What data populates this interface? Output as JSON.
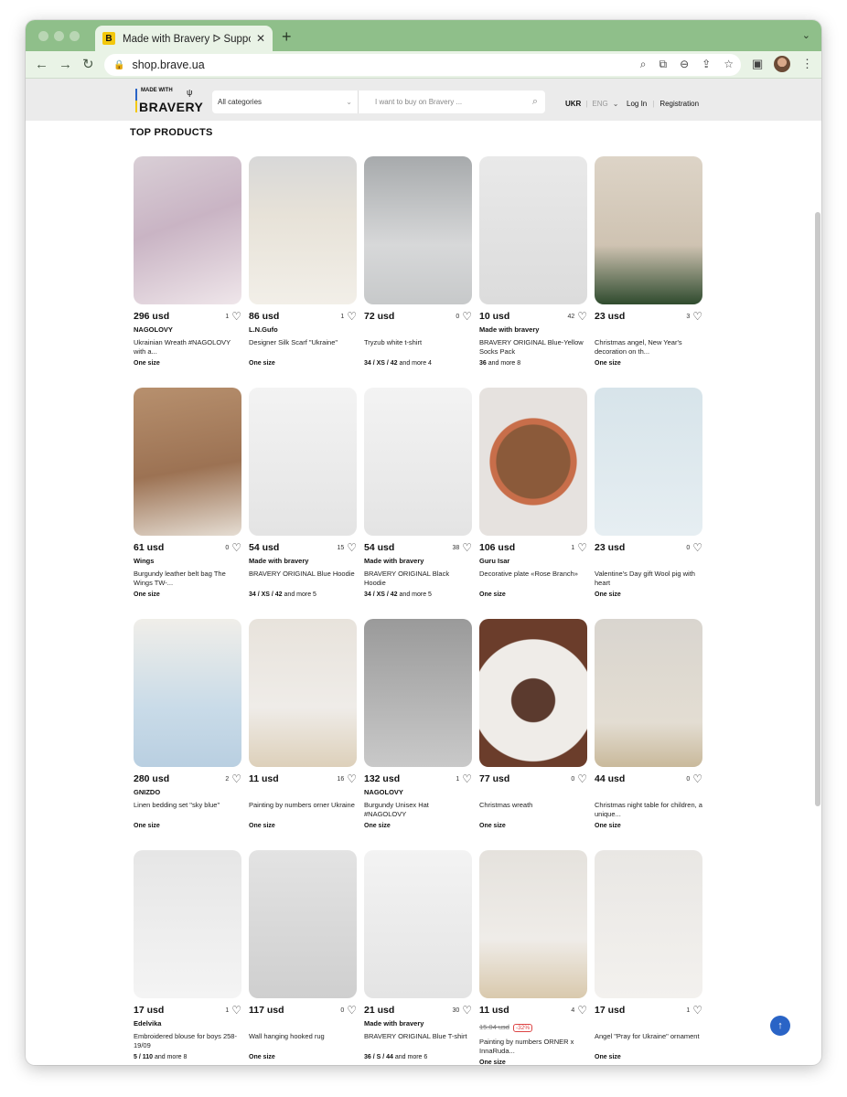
{
  "browser": {
    "tab_title": "Made with Bravery ᐅ Support U",
    "favicon_letter": "B",
    "url": "shop.brave.ua"
  },
  "site": {
    "logo_small": "MADE WITH",
    "logo_big": "BRAVERY",
    "category_select": "All categories",
    "search_placeholder": "I want to buy on Bravery ...",
    "lang_active": "UKR",
    "lang_inactive": "ENG",
    "login": "Log In",
    "register": "Registration",
    "section_title": "TOP PRODUCTS"
  },
  "products": [
    {
      "price": "296 usd",
      "likes": "1",
      "brand": "NAGOLOVY",
      "title": "Ukrainian Wreath #NAGOLOVY with a...",
      "size": "One size",
      "more": ""
    },
    {
      "price": "86 usd",
      "likes": "1",
      "brand": "L.N.Gufo",
      "title": "Designer Silk Scarf \"Ukraine\"",
      "size": "One size",
      "more": ""
    },
    {
      "price": "72 usd",
      "likes": "0",
      "brand": "",
      "title": "Tryzub white t-shirt",
      "size": "34 / XS / 42",
      "more": "and more 4"
    },
    {
      "price": "10 usd",
      "likes": "42",
      "brand": "Made with bravery",
      "title": "BRAVERY ORIGINAL Blue-Yellow Socks Pack",
      "size": "36",
      "more": "and more 8"
    },
    {
      "price": "23 usd",
      "likes": "3",
      "brand": "",
      "title": "Christmas angel, New Year's decoration on th...",
      "size": "One size",
      "more": ""
    },
    {
      "price": "61 usd",
      "likes": "0",
      "brand": "Wings",
      "title": "Burgundy leather belt bag The Wings TW-...",
      "size": "One size",
      "more": ""
    },
    {
      "price": "54 usd",
      "likes": "15",
      "brand": "Made with bravery",
      "title": "BRAVERY ORIGINAL Blue Hoodie",
      "size": "34 / XS / 42",
      "more": "and more 5"
    },
    {
      "price": "54 usd",
      "likes": "38",
      "brand": "Made with bravery",
      "title": "BRAVERY ORIGINAL Black Hoodie",
      "size": "34 / XS / 42",
      "more": "and more 5"
    },
    {
      "price": "106 usd",
      "likes": "1",
      "brand": "Guru Isar",
      "title": "Decorative plate «Rose Branch»",
      "size": "One size",
      "more": ""
    },
    {
      "price": "23 usd",
      "likes": "0",
      "brand": "",
      "title": "Valentine's Day gift Wool pig with heart",
      "size": "One size",
      "more": ""
    },
    {
      "price": "280 usd",
      "likes": "2",
      "brand": "GNIZDO",
      "title": "Linen bedding set \"sky blue\"",
      "size": "One size",
      "more": ""
    },
    {
      "price": "11 usd",
      "likes": "16",
      "brand": "",
      "title": "Painting by numbers orner Ukraine",
      "size": "One size",
      "more": ""
    },
    {
      "price": "132 usd",
      "likes": "1",
      "brand": "NAGOLOVY",
      "title": "Burgundy Unisex Hat #NAGOLOVY",
      "size": "One size",
      "more": ""
    },
    {
      "price": "77 usd",
      "likes": "0",
      "brand": "",
      "title": "Christmas wreath",
      "size": "One size",
      "more": ""
    },
    {
      "price": "44 usd",
      "likes": "0",
      "brand": "",
      "title": "Christmas night table for children, a unique...",
      "size": "One size",
      "more": ""
    },
    {
      "price": "17 usd",
      "likes": "1",
      "brand": "Edelvika",
      "title": "Embroidered blouse for boys 258-19/09",
      "size": "5 / 110",
      "more": "and more 8"
    },
    {
      "price": "117 usd",
      "likes": "0",
      "brand": "",
      "title": "Wall hanging hooked rug",
      "size": "One size",
      "more": ""
    },
    {
      "price": "21 usd",
      "likes": "30",
      "brand": "Made with bravery",
      "title": "BRAVERY ORIGINAL Blue T-shirt",
      "size": "36 / S / 44",
      "more": "and more 6"
    },
    {
      "price": "11 usd",
      "old_price": "15.04 usd",
      "discount": "-32%",
      "likes": "4",
      "brand": "",
      "title": "Painting by numbers ORNER x InnaRuda...",
      "size": "One size",
      "more": ""
    },
    {
      "price": "17 usd",
      "likes": "1",
      "brand": "",
      "title": "Angel \"Pray for Ukraine\" ornament",
      "size": "One size",
      "more": ""
    }
  ]
}
